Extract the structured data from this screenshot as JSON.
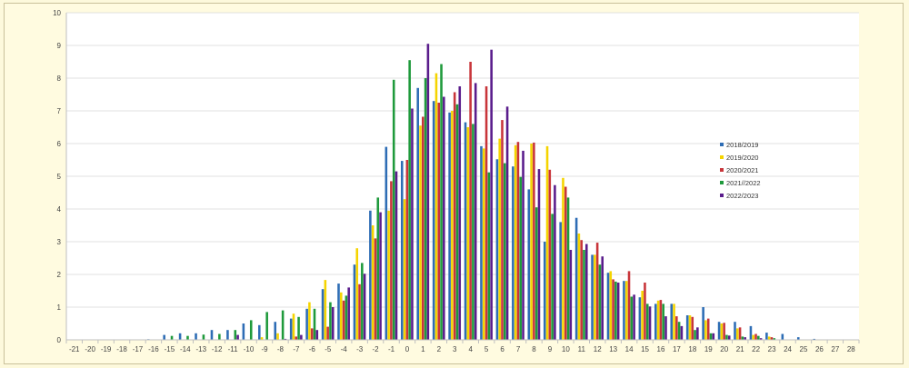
{
  "chart_data": {
    "type": "bar",
    "title": "",
    "xlabel": "",
    "ylabel": "",
    "ylim": [
      0,
      10
    ],
    "yticks": [
      0,
      1,
      2,
      3,
      4,
      5,
      6,
      7,
      8,
      9,
      10
    ],
    "grid": "horizontal",
    "legend_position": "right",
    "categories": [
      -21,
      -20,
      -19,
      -18,
      -17,
      -16,
      -15,
      -14,
      -13,
      -12,
      -11,
      -10,
      -9,
      -8,
      -7,
      -6,
      -5,
      -4,
      -3,
      -2,
      -1,
      0,
      1,
      2,
      3,
      4,
      5,
      6,
      7,
      8,
      9,
      10,
      11,
      12,
      13,
      14,
      15,
      16,
      17,
      18,
      19,
      20,
      21,
      22,
      23,
      24,
      25,
      26,
      27,
      28
    ],
    "series": [
      {
        "name": "2018/2019",
        "color": "#2e6db5",
        "values": [
          0,
          0,
          0,
          0,
          0,
          0.02,
          0.15,
          0.2,
          0.2,
          0.3,
          0.3,
          0.5,
          0.45,
          0.55,
          0.65,
          0.95,
          1.55,
          1.72,
          2.3,
          3.95,
          5.9,
          5.47,
          7.7,
          7.3,
          6.95,
          6.65,
          5.92,
          5.52,
          5.3,
          4.6,
          3.0,
          3.6,
          3.73,
          2.6,
          2.05,
          1.8,
          1.3,
          1.1,
          1.1,
          0.75,
          1.0,
          0.55,
          0.55,
          0.42,
          0.22,
          0.18,
          0.08,
          0.03,
          0,
          0
        ]
      },
      {
        "name": "2019/2020",
        "color": "#f5d400",
        "values": [
          0,
          0,
          0,
          0,
          0,
          0,
          0,
          0,
          0,
          0,
          0,
          0,
          0.08,
          0.2,
          0.8,
          1.15,
          1.83,
          1.45,
          2.8,
          3.5,
          3.95,
          4.3,
          6.55,
          8.15,
          7.0,
          6.5,
          5.85,
          6.15,
          5.95,
          6.0,
          5.92,
          4.95,
          3.25,
          2.6,
          2.1,
          1.8,
          1.5,
          1.2,
          1.1,
          0.75,
          0.6,
          0.5,
          0.35,
          0.15,
          0.1,
          0,
          0,
          0,
          0,
          0
        ]
      },
      {
        "name": "2020/2021",
        "color": "#c8353a",
        "values": [
          0,
          0,
          0,
          0,
          0,
          0,
          0,
          0,
          0,
          0,
          0,
          0,
          0,
          0,
          0.1,
          0.35,
          0.4,
          1.2,
          1.7,
          3.1,
          4.85,
          5.5,
          6.82,
          7.25,
          7.57,
          8.5,
          7.75,
          6.72,
          6.05,
          6.03,
          5.2,
          4.68,
          3.05,
          2.97,
          1.85,
          2.1,
          1.75,
          1.22,
          0.72,
          0.7,
          0.65,
          0.52,
          0.38,
          0.18,
          0.08,
          0,
          0,
          0,
          0,
          0
        ]
      },
      {
        "name": "2021//2022",
        "color": "#1f9a3c",
        "values": [
          0,
          0,
          0,
          0,
          0,
          0,
          0.12,
          0.12,
          0.16,
          0.18,
          0.3,
          0.6,
          0.85,
          0.9,
          0.7,
          0.95,
          1.15,
          1.35,
          2.35,
          4.35,
          7.95,
          8.55,
          8.0,
          8.43,
          7.2,
          6.6,
          5.12,
          5.4,
          4.98,
          4.05,
          3.85,
          4.35,
          2.75,
          2.3,
          1.78,
          1.32,
          1.1,
          1.1,
          0.55,
          0.3,
          0.2,
          0.15,
          0.1,
          0.12,
          0.05,
          0,
          0,
          0,
          0,
          0
        ]
      },
      {
        "name": "2022/2023",
        "color": "#5a1d8c",
        "values": [
          0,
          0,
          0,
          0,
          0,
          0,
          0,
          0,
          0,
          0,
          0.15,
          0,
          0,
          0.03,
          0.15,
          0.3,
          1.0,
          1.6,
          2.02,
          3.9,
          5.15,
          7.07,
          9.05,
          7.43,
          7.75,
          7.85,
          8.87,
          7.13,
          5.78,
          5.22,
          4.73,
          2.75,
          2.93,
          2.55,
          1.75,
          1.38,
          1.02,
          0.72,
          0.42,
          0.38,
          0.2,
          0.13,
          0.08,
          0.05,
          0,
          0,
          0,
          0,
          0,
          0
        ]
      }
    ]
  }
}
